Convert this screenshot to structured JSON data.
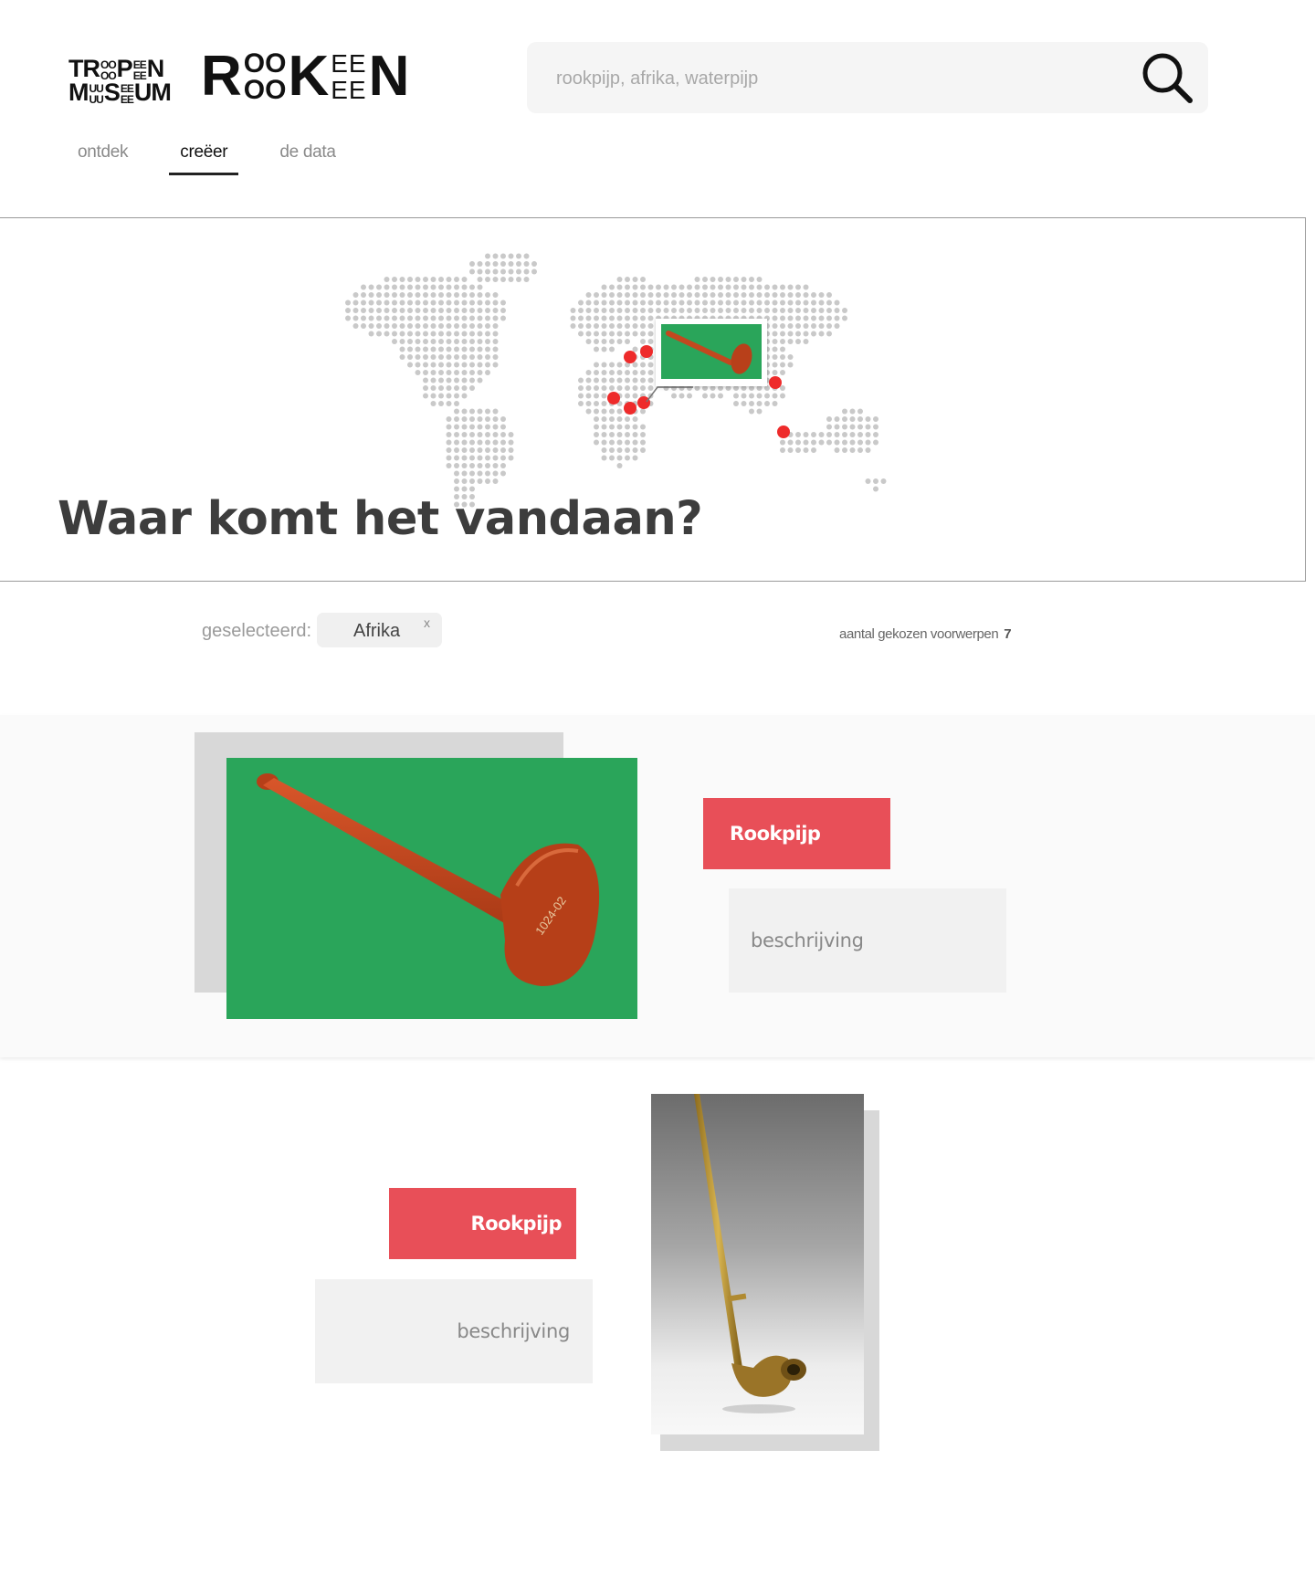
{
  "header": {
    "logo_tropenmuseum": {
      "top_big": "TR",
      "top_stack_1": "OO",
      "top_stack_2": "OO",
      "top_mid": "P",
      "top_stack_3": "EE",
      "top_stack_4": "EE",
      "top_end": "N",
      "bottom_big": "M",
      "bottom_stack_1": "UU",
      "bottom_stack_2": "UU",
      "bottom_mid": "S",
      "bottom_stack_3": "EE",
      "bottom_stack_4": "EE",
      "bottom_end": "UM"
    },
    "logo_rookeen": {
      "start": "R",
      "stack_top_1": "OO",
      "stack_bottom_1": "OO",
      "mid": "K",
      "stack_top_2": "EE",
      "stack_bottom_2": "EE",
      "end": "N"
    },
    "search": {
      "placeholder": "rookpijp, afrika, waterpijp",
      "icon": "search-icon"
    },
    "nav": [
      {
        "label": "ontdek",
        "active": false
      },
      {
        "label": "creëer",
        "active": true
      },
      {
        "label": "de data",
        "active": false
      }
    ]
  },
  "hero": {
    "title": "Waar komt het vandaan?",
    "marker_color": "#ee2b2b"
  },
  "filter": {
    "selected_label": "geselecteerd:",
    "chips": [
      {
        "label": "Afrika",
        "remove": "x"
      }
    ],
    "count_label": "aantal gekozen voorwerpen",
    "count_value": "7"
  },
  "items": [
    {
      "title": "Rookpijp",
      "description": "beschrijving",
      "image": "red-clay-pipe-on-green"
    },
    {
      "title": "Rookpijp",
      "description": "beschrijving",
      "image": "brass-long-pipe-on-gray"
    }
  ],
  "colors": {
    "accent": "#e84f58",
    "search_bg": "#f5f5f5",
    "desc_bg": "#f1f1f1",
    "image_green": "#2aa55a"
  }
}
